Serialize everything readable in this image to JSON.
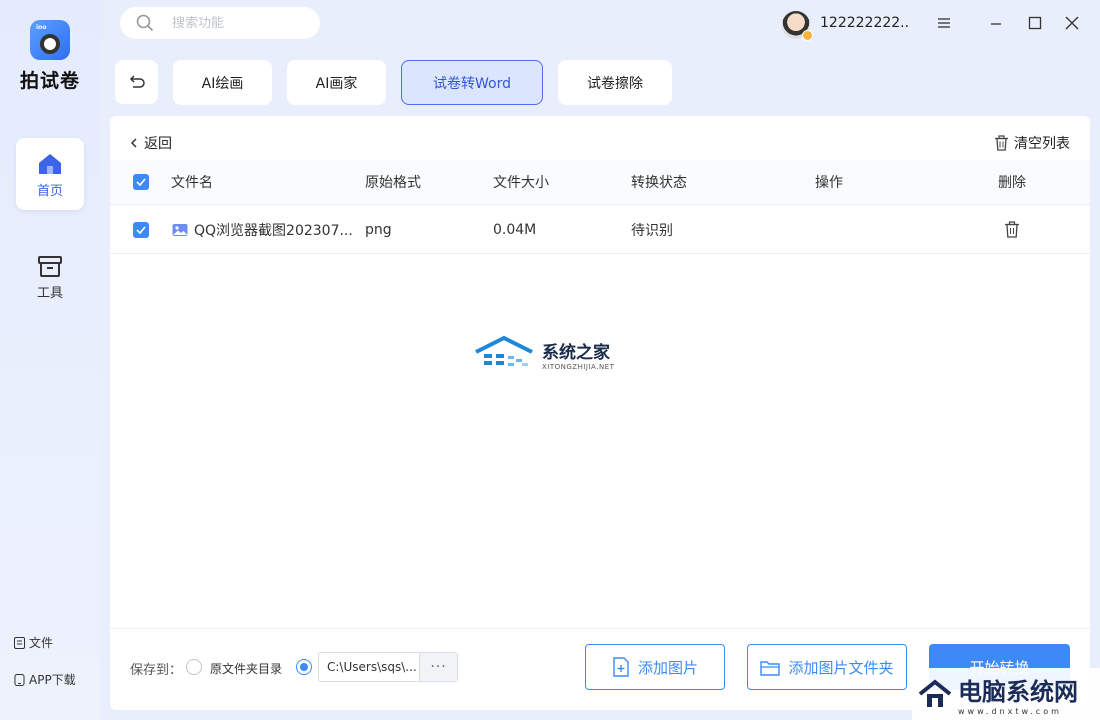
{
  "app": {
    "name": "拍试卷",
    "logo_tag": "ino"
  },
  "search": {
    "placeholder": "搜索功能"
  },
  "user": {
    "name": "122222222..."
  },
  "sidebar": {
    "items": [
      {
        "label": "首页",
        "icon": "home-icon",
        "active": true
      },
      {
        "label": "工具",
        "icon": "toolbox-icon",
        "active": false
      }
    ],
    "bottom_links": [
      {
        "label": "文件",
        "icon": "file-icon"
      },
      {
        "label": "APP下载",
        "icon": "phone-icon"
      }
    ]
  },
  "tabs": [
    {
      "label": "AI绘画"
    },
    {
      "label": "AI画家"
    },
    {
      "label": "试卷转Word",
      "active": true
    },
    {
      "label": "试卷擦除"
    }
  ],
  "panel": {
    "return_label": "返回",
    "clear_label": "清空列表",
    "columns": {
      "name": "文件名",
      "format": "原始格式",
      "size": "文件大小",
      "status": "转换状态",
      "action": "操作",
      "delete": "删除"
    },
    "rows": [
      {
        "name": "QQ浏览器截图202307...",
        "format": "png",
        "size": "0.04M",
        "status": "待识别",
        "checked": true
      }
    ]
  },
  "watermark": {
    "title": "系统之家",
    "subtitle": "XITONGZHIJIA.NET"
  },
  "footer": {
    "save_to_label": "保存到：",
    "option_original": "原文件夹目录",
    "custom_path": "C:\\Users\\sqs\\...",
    "more_label": "···",
    "add_image": "添加图片",
    "add_folder": "添加图片文件夹",
    "start": "开始转换"
  },
  "corner_watermark": {
    "title": "电脑系统网",
    "subtitle": "www.dnxtw.com"
  },
  "colors": {
    "accent": "#3d8af7",
    "active_tab_bg": "#dbe5fd",
    "active_tab_border": "#4b6ff0"
  }
}
